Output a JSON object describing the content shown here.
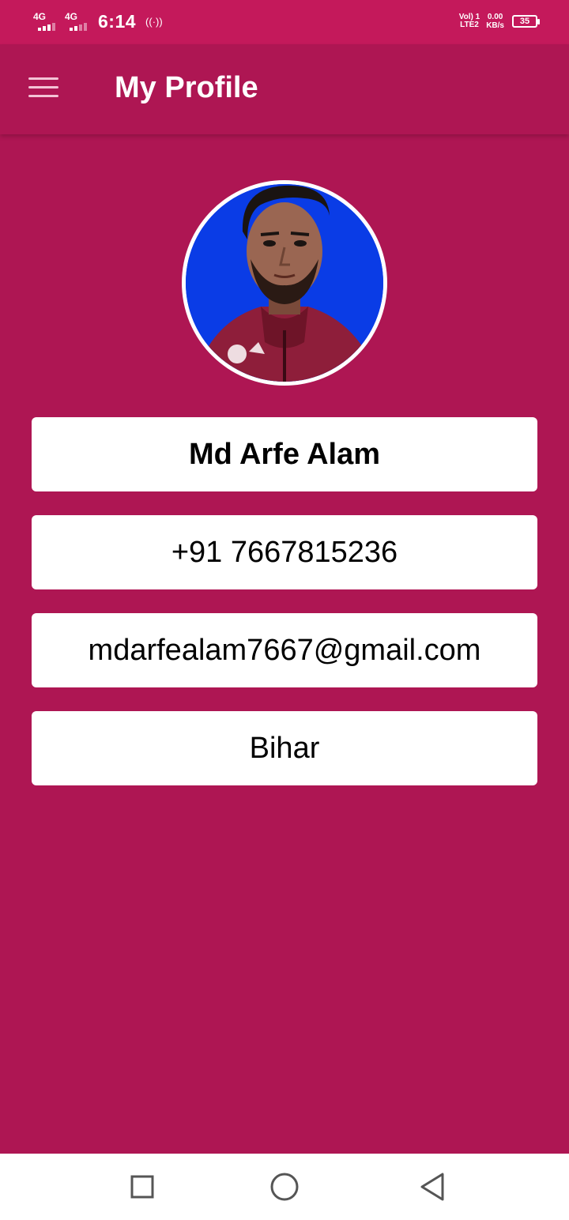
{
  "status_bar": {
    "sim1_network": "4G",
    "sim2_network": "4G",
    "time": "6:14",
    "hotspot_indicator": "((·))",
    "volte_line1": "Vol) 1",
    "volte_line2": "LTE2",
    "speed_value": "0.00",
    "speed_unit": "KB/s",
    "battery_level": "35"
  },
  "app_bar": {
    "title": "My Profile",
    "menu_icon": "hamburger-menu-icon"
  },
  "profile": {
    "photo_description": "profile-photo",
    "name": "Md Arfe Alam",
    "phone": "+91 7667815236",
    "email": "mdarfealam7667@gmail.com",
    "state": "Bihar"
  },
  "navigation_bar": {
    "recents_icon": "square-icon",
    "home_icon": "circle-icon",
    "back_icon": "triangle-back-icon"
  },
  "colors": {
    "status_bar": "#C4195B",
    "primary": "#AE1653",
    "card": "#FFFFFF",
    "avatar_background": "#0A3CE6"
  }
}
